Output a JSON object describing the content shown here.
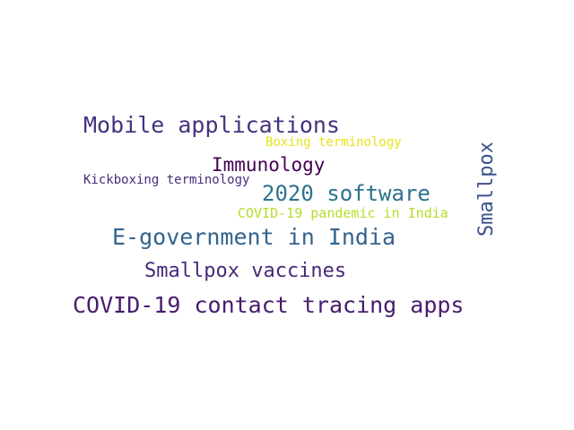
{
  "words": [
    {
      "text": "Mobile applications",
      "color": "#46327e"
    },
    {
      "text": "Boxing terminology",
      "color": "#e7e419"
    },
    {
      "text": "Smallpox",
      "color": "#3b528b"
    },
    {
      "text": "Immunology",
      "color": "#440154"
    },
    {
      "text": "Kickboxing terminology",
      "color": "#472d7b"
    },
    {
      "text": "2020 software",
      "color": "#2c728e"
    },
    {
      "text": "COVID-19 pandemic in India",
      "color": "#b5de2b"
    },
    {
      "text": "E-government in India",
      "color": "#33638d"
    },
    {
      "text": "Smallpox vaccines",
      "color": "#482878"
    },
    {
      "text": "COVID-19 contact tracing apps",
      "color": "#481b6d"
    }
  ]
}
